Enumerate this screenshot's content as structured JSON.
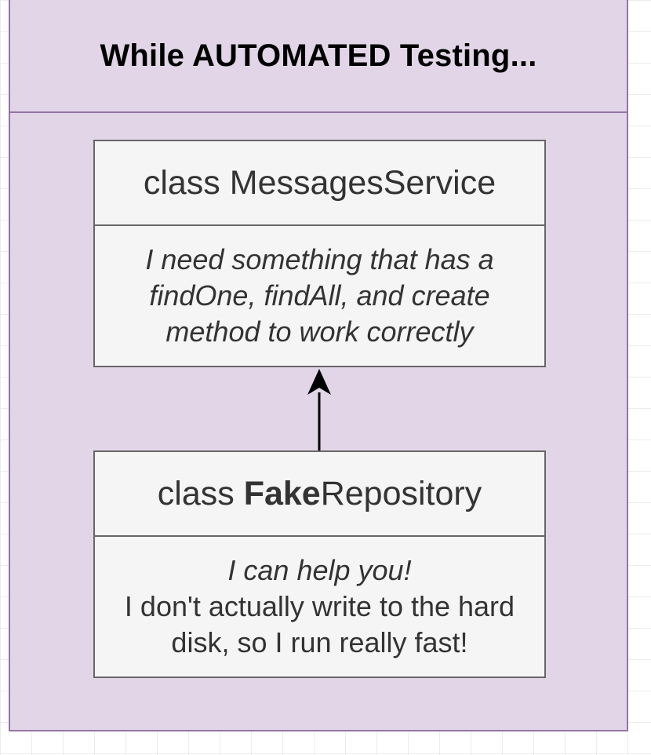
{
  "container": {
    "title": "While AUTOMATED Testing..."
  },
  "messages_service": {
    "prefix": "class ",
    "name": "MessagesService",
    "description": "I need something that has a findOne, findAll, and create method to work correctly"
  },
  "fake_repository": {
    "prefix": "class ",
    "name_bold": "Fake",
    "name_rest": "Repository",
    "tagline": "I can help you!",
    "description": "I don't actually write to the hard disk, so I run really fast!"
  },
  "connector": {
    "from": "fake_repository",
    "to": "messages_service",
    "type": "arrow"
  },
  "colors": {
    "container_fill": "#e1d5e7",
    "container_border": "#9673a6",
    "class_fill": "#f5f5f5",
    "class_border": "#666666",
    "text": "#333333"
  }
}
